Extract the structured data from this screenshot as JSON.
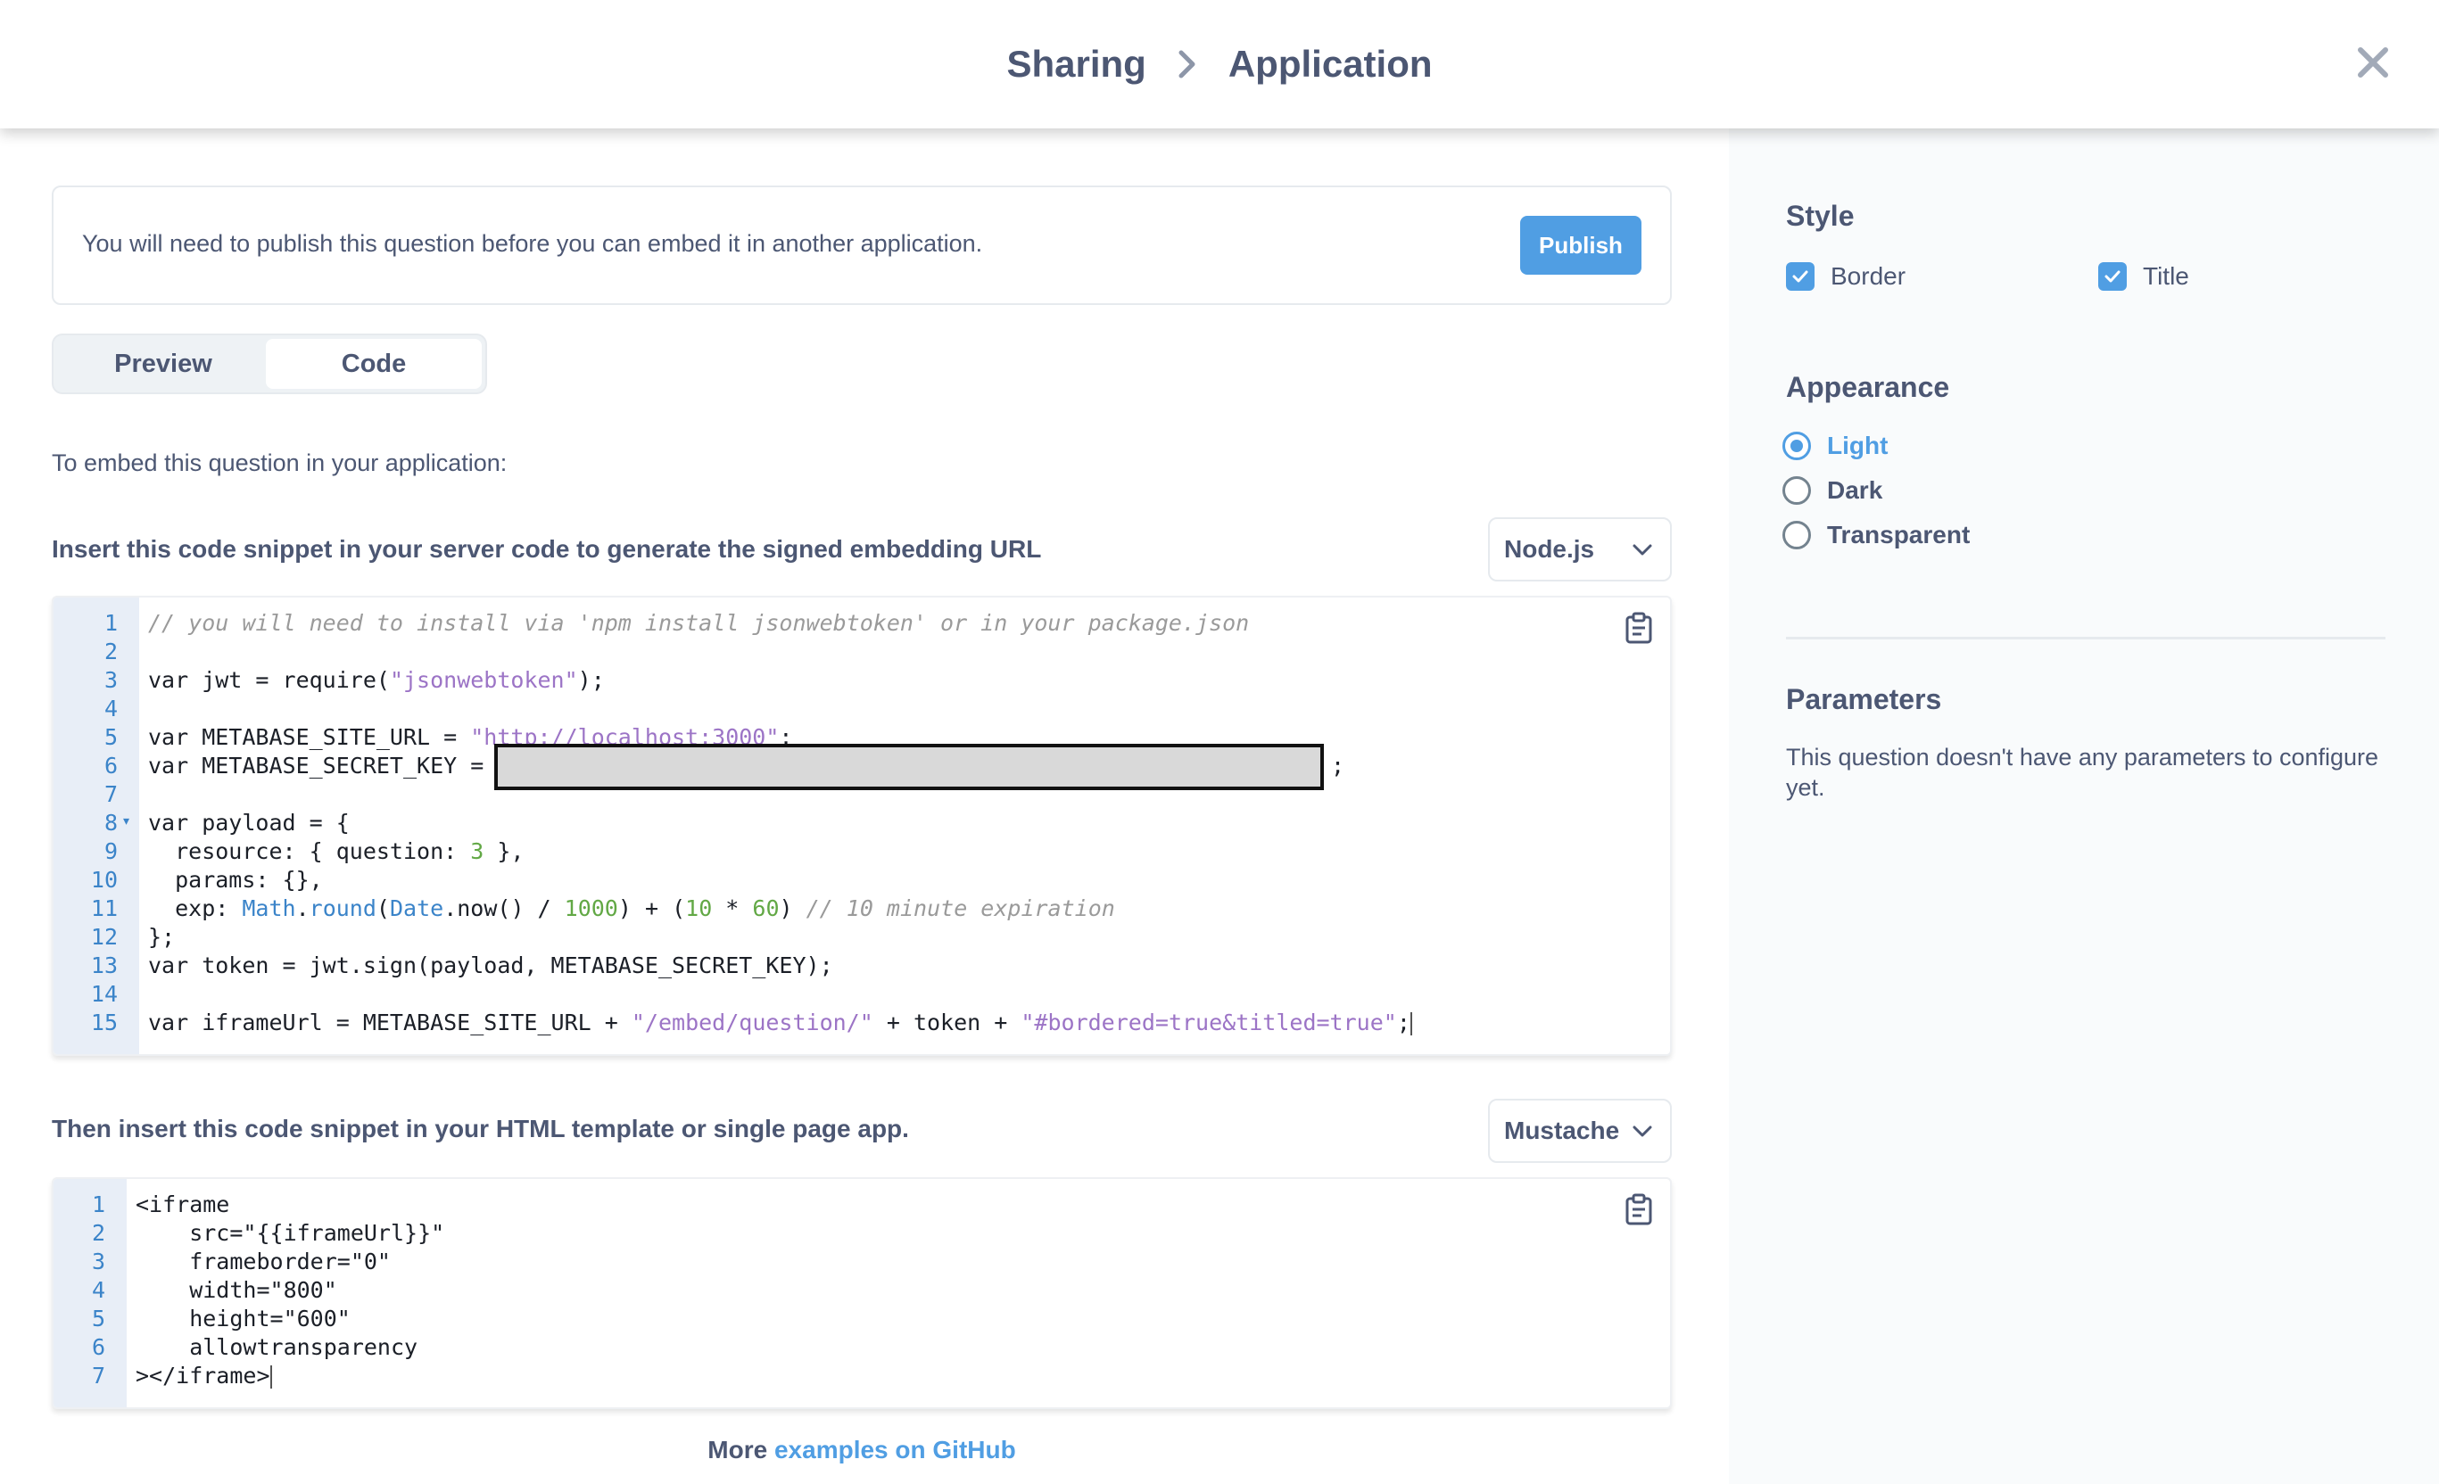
{
  "header": {
    "breadcrumb_parent": "Sharing",
    "breadcrumb_current": "Application",
    "separator_icon": "chevron-right-icon",
    "close_icon": "close-icon"
  },
  "notice": {
    "text": "You will need to publish this question before you can embed it in another application.",
    "publish_label": "Publish"
  },
  "tabs": [
    {
      "label": "Preview",
      "active": false
    },
    {
      "label": "Code",
      "active": true
    }
  ],
  "main": {
    "intro": "To embed this question in your application:",
    "server": {
      "label": "Insert this code snippet in your server code to generate the signed embedding URL",
      "language": "Node.js",
      "code_lines": [
        "// you will need to install via 'npm install jsonwebtoken' or in your package.json",
        "",
        "var jwt = require(\"jsonwebtoken\");",
        "",
        "var METABASE_SITE_URL = \"http://localhost:3000\";",
        "var METABASE_SECRET_KEY = \"",
        "",
        "var payload = {",
        "  resource: { question: 3 },",
        "  params: {},",
        "  exp: Math.round(Date.now() / 1000) + (10 * 60) // 10 minute expiration",
        "};",
        "var token = jwt.sign(payload, METABASE_SECRET_KEY);",
        "",
        "var iframeUrl = METABASE_SITE_URL + \"/embed/question/\" + token + \"#bordered=true&titled=true\";"
      ],
      "secret_tail": ";"
    },
    "client": {
      "label": "Then insert this code snippet in your HTML template or single page app.",
      "language": "Mustache",
      "code_lines": [
        "<iframe",
        "    src=\"{{iframeUrl}}\"",
        "    frameborder=\"0\"",
        "    width=\"800\"",
        "    height=\"600\"",
        "    allowtransparency",
        "></iframe>"
      ]
    },
    "more_prefix": "More",
    "more_link": "examples on GitHub"
  },
  "sidebar": {
    "style_heading": "Style",
    "style_options": [
      {
        "label": "Border",
        "checked": true
      },
      {
        "label": "Title",
        "checked": true
      }
    ],
    "appearance_heading": "Appearance",
    "appearance_options": [
      {
        "label": "Light",
        "selected": true
      },
      {
        "label": "Dark",
        "selected": false
      },
      {
        "label": "Transparent",
        "selected": false
      }
    ],
    "parameters_heading": "Parameters",
    "parameters_text": "This question doesn't have any parameters to configure yet."
  },
  "colors": {
    "brand": "#509ee3",
    "text": "#4c5773",
    "code_string": "#9c74c6",
    "code_number": "#62a845",
    "code_comment": "#9a9a9a"
  }
}
